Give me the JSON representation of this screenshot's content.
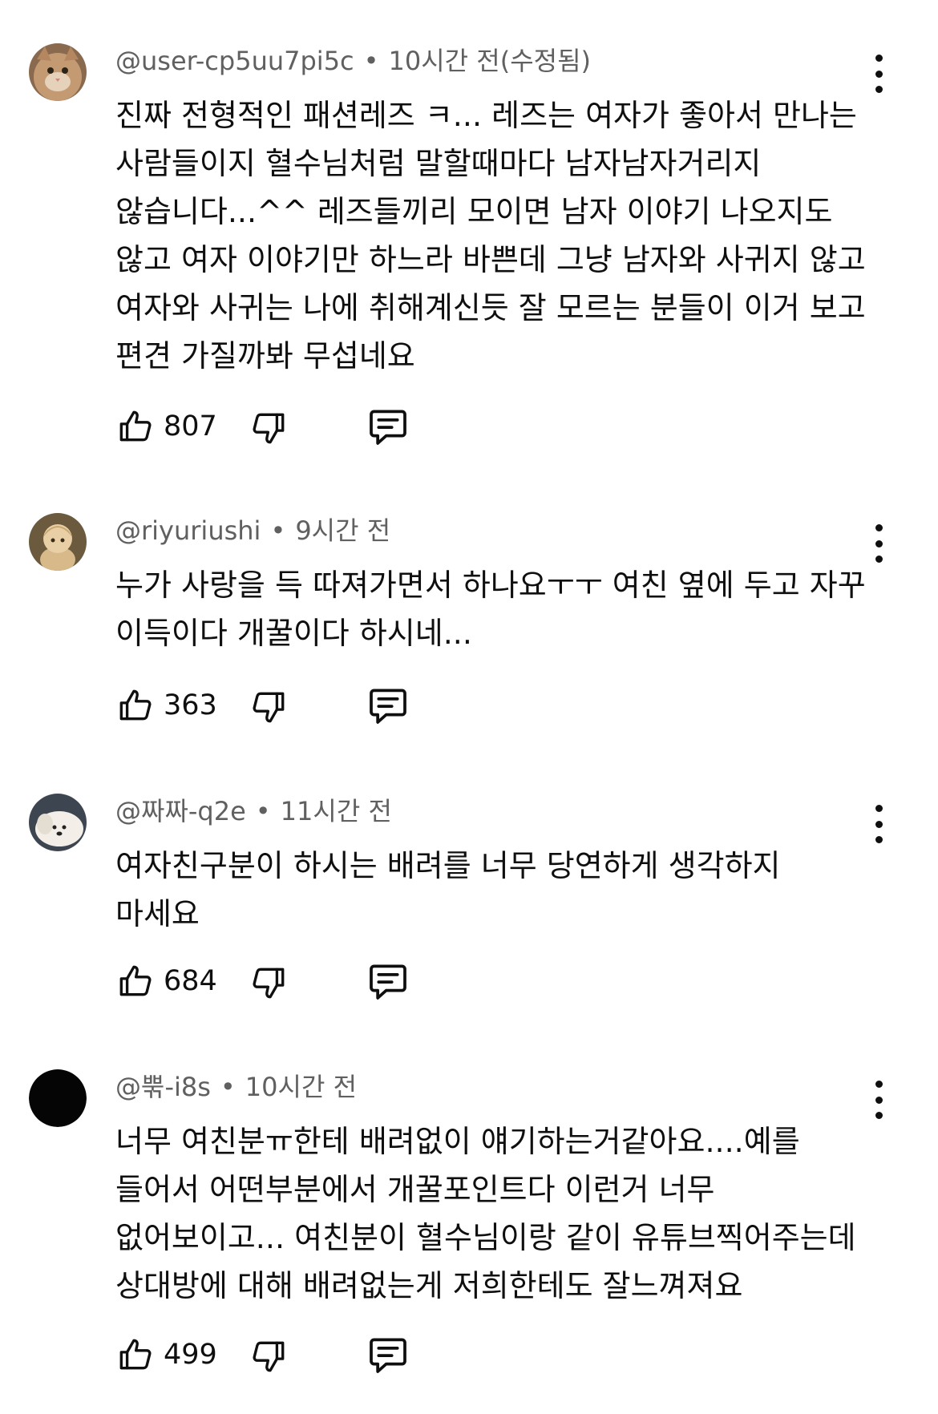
{
  "comments": [
    {
      "author": "@user-cp5uu7pi5c",
      "separator": "•",
      "time": "10시간 전(수정됨)",
      "text": "진짜 전형적인 패션레즈 ㅋ... 레즈는 여자가 좋아서 만나는 사람들이지 혈수님처럼 말할때마다 남자남자거리지 않습니다...^^ 레즈들끼리 모이면 남자 이야기 나오지도 않고 여자 이야기만 하느라 바쁜데 그냥 남자와 사귀지 않고 여자와 사귀는 나에 취해계신듯 잘 모르는 분들이 이거 보고 편견 가질까봐 무섭네요",
      "likes": "807",
      "avatar_icon": "cat-avatar-icon"
    },
    {
      "author": "@riyuriushi",
      "separator": "•",
      "time": "9시간 전",
      "text": "누가 사랑을 득 따져가면서 하나요ㅜㅜ 여친 옆에 두고 자꾸 이득이다 개꿀이다 하시네...",
      "likes": "363",
      "avatar_icon": "figurine-avatar-icon"
    },
    {
      "author": "@짜짜-q2e",
      "separator": "•",
      "time": "11시간 전",
      "text": "여자친구분이 하시는 배려를 너무 당연하게 생각하지 마세요",
      "likes": "684",
      "avatar_icon": "puppy-avatar-icon"
    },
    {
      "author": "@뿎-i8s",
      "separator": "•",
      "time": "10시간 전",
      "text": "너무 여친분ㅠ한테 배려없이 얘기하는거같아요....예를 들어서 어떤부분에서 개꿀포인트다 이런거 너무 없어보이고... 여친분이 혈수님이랑 같이 유튜브찍어주는데 상대방에 대해 배려없는게 저희한테도 잘느껴져요",
      "likes": "499",
      "avatar_icon": "black-avatar-icon"
    }
  ],
  "colors": {
    "text": "#0f0f0f",
    "meta": "#606060",
    "background": "#ffffff"
  },
  "icons": {
    "like": "thumbs-up-icon",
    "dislike": "thumbs-down-icon",
    "reply": "reply-icon",
    "more": "more-vertical-icon"
  }
}
